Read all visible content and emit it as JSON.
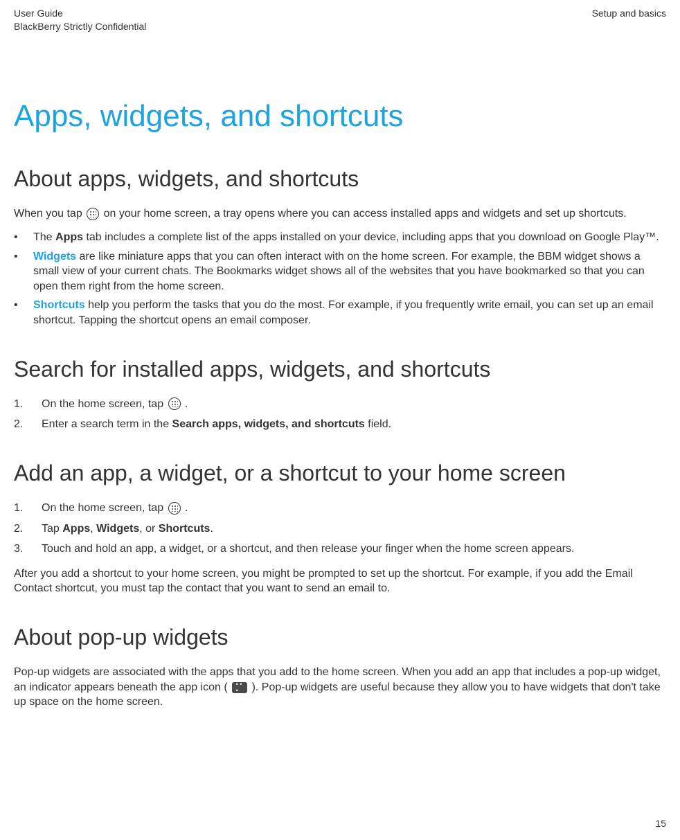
{
  "header": {
    "left_line1": "User Guide",
    "left_line2": "BlackBerry Strictly Confidential",
    "right": "Setup and basics"
  },
  "main_title": "Apps, widgets, and shortcuts",
  "section_about": {
    "title": "About apps, widgets, and shortcuts",
    "intro_pre": "When you tap ",
    "intro_post": " on your home screen, a tray opens where you can access installed apps and widgets and set up shortcuts.",
    "bullets": [
      {
        "lead_pre": "The ",
        "lead_bold": "Apps",
        "tail": " tab includes a complete list of the apps installed on your device, including apps that you download on Google Play™."
      },
      {
        "lead_bold_blue": "Widgets",
        "tail": " are like miniature apps that you can often interact with on the home screen. For example, the BBM widget shows a small view of your current chats. The Bookmarks widget shows all of the websites that you have bookmarked so that you can open them right from the home screen."
      },
      {
        "lead_bold_blue": "Shortcuts",
        "tail": " help you perform the tasks that you do the most. For example, if you frequently write email, you can set up an email shortcut. Tapping the shortcut opens an email composer."
      }
    ]
  },
  "section_search": {
    "title": "Search for installed apps, widgets, and shortcuts",
    "steps": [
      {
        "num": "1.",
        "pre": "On the home screen, tap ",
        "post": " ."
      },
      {
        "num": "2.",
        "pre": "Enter a search term in the ",
        "bold": "Search apps, widgets, and shortcuts",
        "post": " field."
      }
    ]
  },
  "section_add": {
    "title": "Add an app, a widget, or a shortcut to your home screen",
    "steps": [
      {
        "num": "1.",
        "pre": "On the home screen, tap ",
        "post": " ."
      },
      {
        "num": "2.",
        "pre": "Tap ",
        "b1": "Apps",
        "sep1": ", ",
        "b2": "Widgets",
        "sep2": ", or ",
        "b3": "Shortcuts",
        "post": "."
      },
      {
        "num": "3.",
        "text": "Touch and hold an app, a widget, or a shortcut, and then release your finger when the home screen appears."
      }
    ],
    "after": "After you add a shortcut to your home screen, you might be prompted to set up the shortcut. For example, if you add the Email Contact shortcut, you must tap the contact that you want to send an email to."
  },
  "section_popup": {
    "title": "About pop-up widgets",
    "para_pre": "Pop-up widgets are associated with the apps that you add to the home screen. When you add an app that includes a pop-up widget, an indicator appears beneath the app icon ( ",
    "para_post": " ). Pop-up widgets are useful because they allow you to have widgets that don't take up space on the home screen."
  },
  "page_number": "15"
}
